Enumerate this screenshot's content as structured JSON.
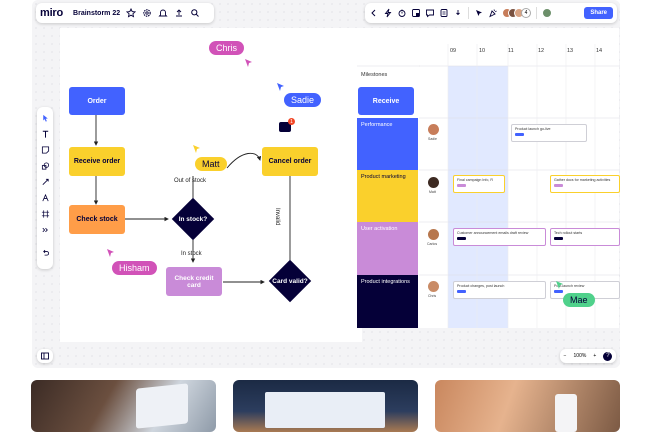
{
  "app": {
    "logo": "miro",
    "board_name": "Brainstorm 22",
    "share_label": "Share",
    "collaborator_count": "4",
    "zoom_level": "100%",
    "zoom_out": "−",
    "zoom_in": "+",
    "help": "?"
  },
  "flowchart": {
    "order": "Order",
    "receive_order": "Receive order",
    "check_stock": "Check stock",
    "in_stock_q": "In stock?",
    "out_of_stock": "Out of stock",
    "cancel_order": "Cancel order",
    "in_stock": "In stock",
    "check_credit_card": "Check credit card",
    "card_valid": "Card valid?",
    "invalid": "Invalid"
  },
  "cursors": {
    "chris": "Chris",
    "sadie": "Sadie",
    "matt": "Matt",
    "hisham": "Hisham",
    "mae": "Mae"
  },
  "comment_badge": "1",
  "timeline": {
    "columns": [
      "09",
      "10",
      "11",
      "12",
      "13",
      "14"
    ],
    "milestones_label": "Milestones",
    "receive_label": "Receive",
    "lanes": [
      {
        "name": "Performance",
        "person": "Sadie",
        "color": "#4262ff"
      },
      {
        "name": "Product marketing",
        "person": "Matt",
        "color": "#fad02c"
      },
      {
        "name": "User activation",
        "person": "Carlos",
        "color": "#c98bd8"
      },
      {
        "name": "Product integrations",
        "person": "Chris",
        "color": "#050038"
      }
    ],
    "cards": [
      {
        "text": "Product launch go-live"
      },
      {
        "text": "Final campaign Info, R"
      },
      {
        "text": "Gather docs for marketing activities"
      },
      {
        "text": "Customer announcement emails draft review"
      },
      {
        "text": "Tech rollout starts"
      },
      {
        "text": "Product changes, post launch"
      },
      {
        "text": "Post-launch review"
      }
    ]
  },
  "colors": {
    "accent": "#4262ff",
    "navy": "#050038",
    "yellow": "#fad02c",
    "orange": "#ff9d48",
    "purple": "#c98bd8",
    "pink": "#d152b8",
    "green": "#4fd18b"
  }
}
